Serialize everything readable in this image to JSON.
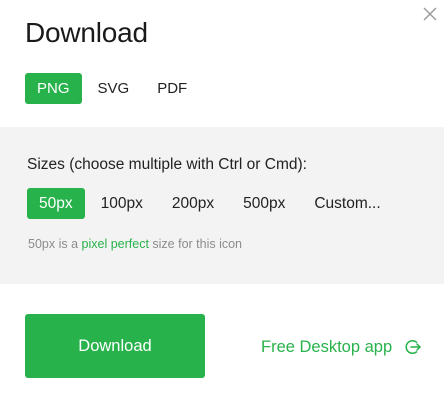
{
  "dialog": {
    "title": "Download",
    "close_icon": "close-icon"
  },
  "formats": {
    "selected": "PNG",
    "items": [
      {
        "label": "PNG",
        "active": true
      },
      {
        "label": "SVG",
        "active": false
      },
      {
        "label": "PDF",
        "active": false
      }
    ]
  },
  "sizes": {
    "label": "Sizes (choose multiple with Ctrl or Cmd):",
    "options": [
      {
        "label": "50px",
        "active": true
      },
      {
        "label": "100px",
        "active": false
      },
      {
        "label": "200px",
        "active": false
      },
      {
        "label": "500px",
        "active": false
      },
      {
        "label": "Custom...",
        "active": false
      }
    ],
    "note_prefix": "50px is a ",
    "note_link": "pixel perfect",
    "note_suffix": " size for this icon"
  },
  "actions": {
    "download_label": "Download",
    "desktop_link_label": "Free Desktop app",
    "desktop_link_icon": "arrow-circle-right-icon"
  },
  "colors": {
    "accent": "#28b24b",
    "panel_bg": "#f3f3f3",
    "muted_text": "#8c8c8c"
  }
}
